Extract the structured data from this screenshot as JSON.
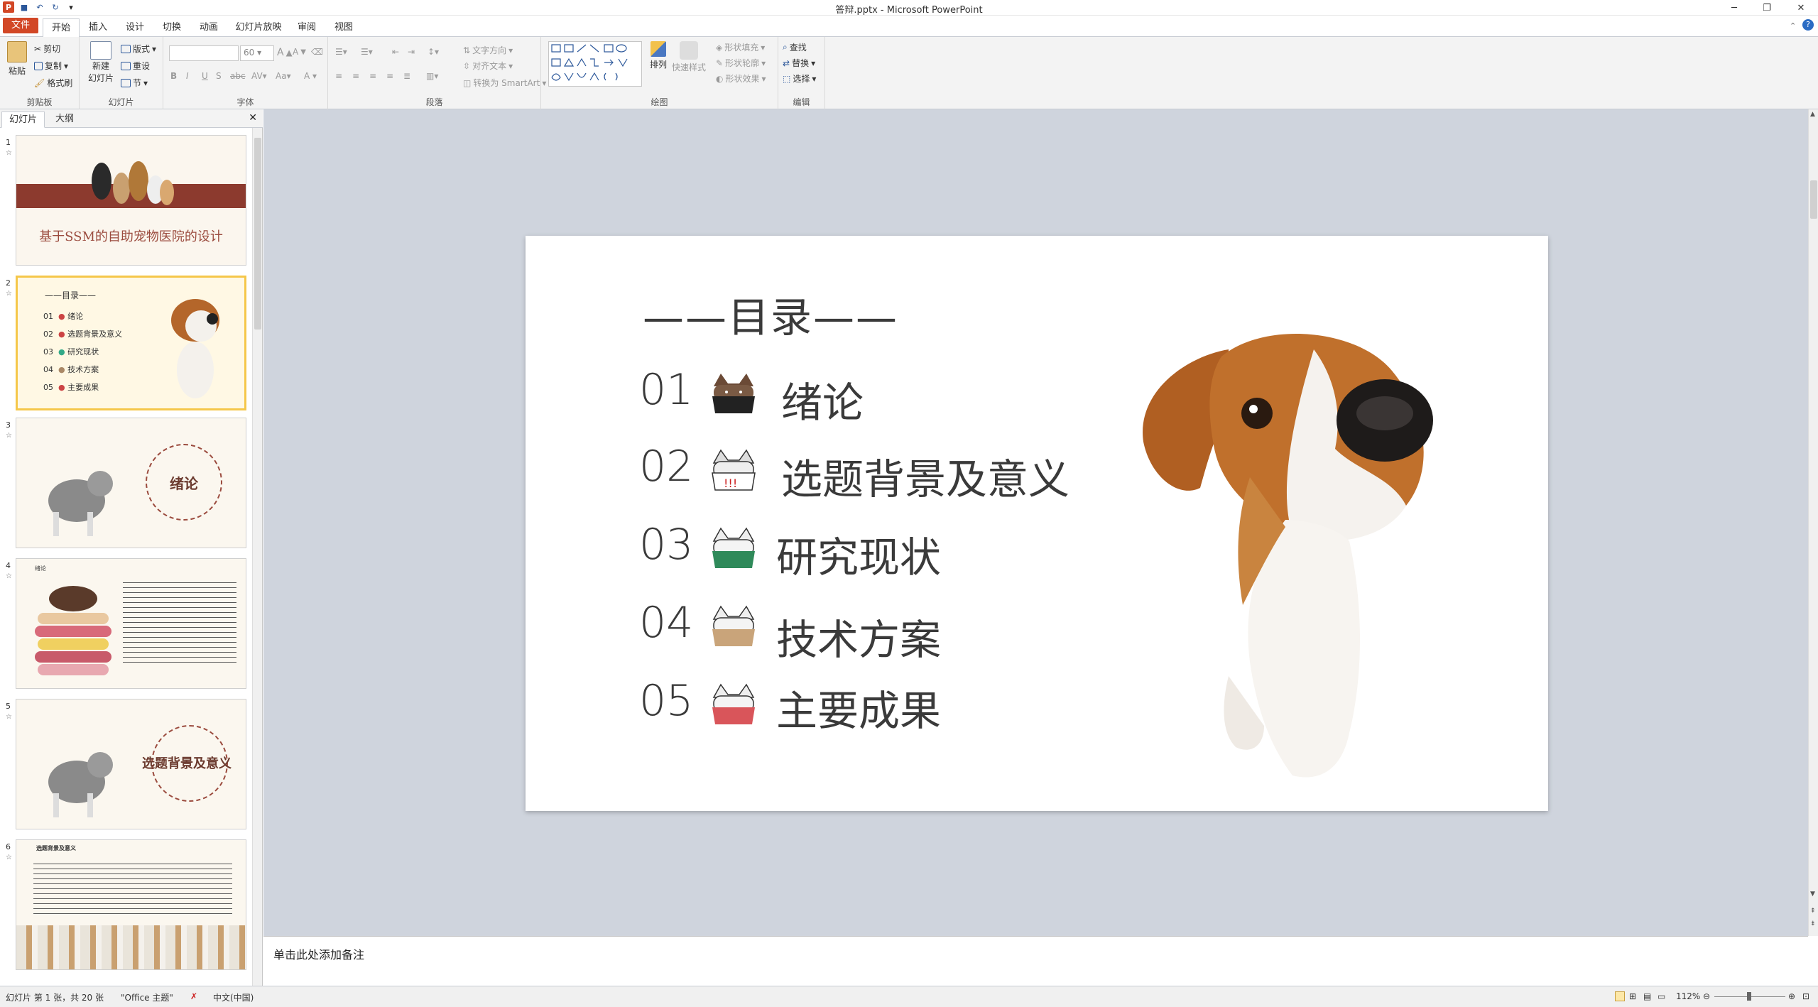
{
  "window": {
    "title": "答辩.pptx - Microsoft PowerPoint"
  },
  "tabs": [
    "文件",
    "开始",
    "插入",
    "设计",
    "切换",
    "动画",
    "幻灯片放映",
    "审阅",
    "视图"
  ],
  "ribbon": {
    "clipboard": {
      "label": "剪贴板",
      "paste": "粘贴",
      "cut": "剪切",
      "copy": "复制",
      "format_painter": "格式刷"
    },
    "slides": {
      "label": "幻灯片",
      "new_slide": "新建",
      "new_slide2": "幻灯片",
      "layout": "版式",
      "reset": "重设",
      "section": "节"
    },
    "font": {
      "label": "字体",
      "size": "60"
    },
    "paragraph": {
      "label": "段落",
      "text_direction": "文字方向",
      "align_text": "对齐文本",
      "smartart": "转换为 SmartArt"
    },
    "drawing": {
      "label": "绘图",
      "arrange": "排列",
      "quick_styles": "快速样式",
      "shape_fill": "形状填充",
      "shape_outline": "形状轮廓",
      "shape_effects": "形状效果"
    },
    "editing": {
      "label": "编辑",
      "find": "查找",
      "replace": "替换",
      "select": "选择"
    }
  },
  "pane": {
    "tab_slides": "幻灯片",
    "tab_outline": "大纲"
  },
  "thumbnails": [
    {
      "num": "1",
      "title": "基于SSM的自助宠物医院的设计"
    },
    {
      "num": "2",
      "title": "——目录——",
      "items": [
        [
          "01",
          "绪论"
        ],
        [
          "02",
          "选题背景及意义"
        ],
        [
          "03",
          "研究现状"
        ],
        [
          "04",
          "技术方案"
        ],
        [
          "05",
          "主要成果"
        ]
      ]
    },
    {
      "num": "3",
      "title": "绪论"
    },
    {
      "num": "4",
      "title": "绪论"
    },
    {
      "num": "5",
      "title": "选题背景及意义"
    },
    {
      "num": "6",
      "title": "选题背景及意义"
    }
  ],
  "slide": {
    "title": "——目录——",
    "items": [
      {
        "num": "01",
        "label": "绪论"
      },
      {
        "num": "02",
        "label": "选题背景及意义"
      },
      {
        "num": "03",
        "label": "研究现状"
      },
      {
        "num": "04",
        "label": "技术方案"
      },
      {
        "num": "05",
        "label": "主要成果"
      }
    ]
  },
  "notes": {
    "placeholder": "单击此处添加备注"
  },
  "status": {
    "slide_info": "幻灯片 第 1 张，共 20 张",
    "theme": "\"Office 主题\"",
    "language": "中文(中国)",
    "zoom": "112%"
  },
  "colors": {
    "file_tab": "#d24726",
    "thumb_selected": "#f5c74a",
    "canvas": "#cfd4dd"
  }
}
